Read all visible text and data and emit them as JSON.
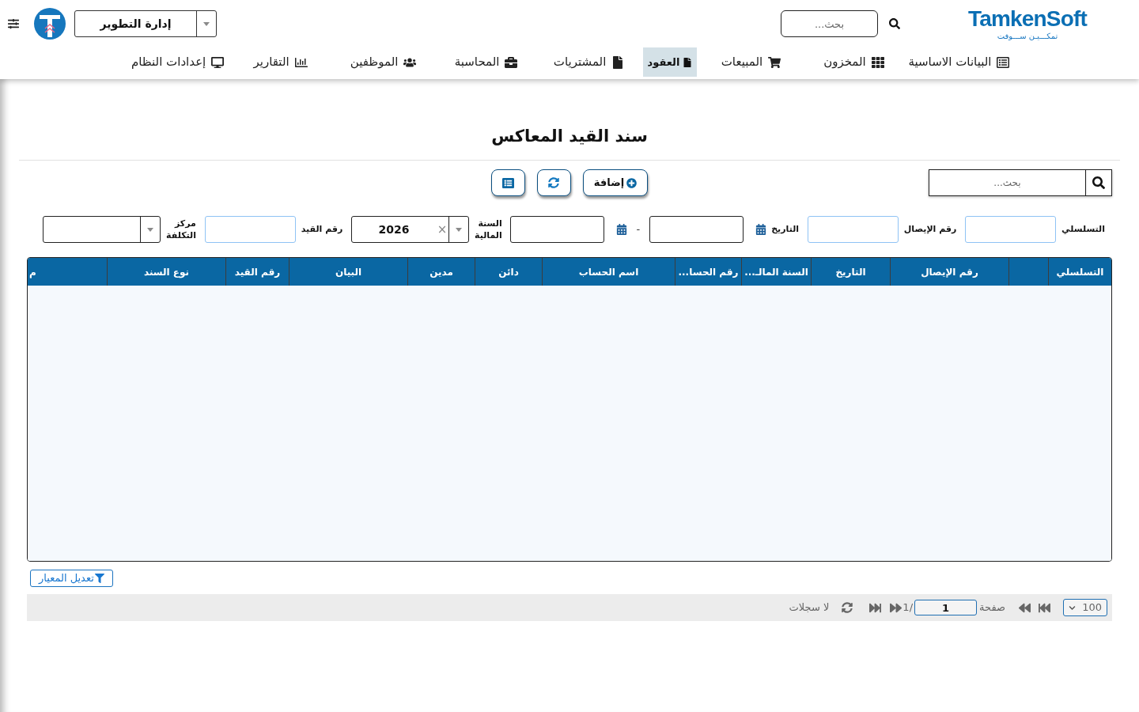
{
  "header": {
    "logo": {
      "name": "TamkenSoft",
      "tagline": "تمكـــيـن ســـوفت"
    },
    "search": {
      "placeholder": "بحث..."
    },
    "department": {
      "value": "إدارة التطوير"
    }
  },
  "nav": [
    {
      "label": "البيانات الاساسية",
      "selected": false
    },
    {
      "label": "المخزون",
      "selected": false
    },
    {
      "label": "المبيعات",
      "selected": false
    },
    {
      "label": "العقود",
      "selected": true
    },
    {
      "label": "المشتريات",
      "selected": false
    },
    {
      "label": "المحاسبة",
      "selected": false
    },
    {
      "label": "الموظفين",
      "selected": false
    },
    {
      "label": "التقارير",
      "selected": false
    },
    {
      "label": "إعدادات النظام",
      "selected": false
    }
  ],
  "page": {
    "title": "سند القيد المعاكس"
  },
  "toolbar": {
    "add_button": "إضافة",
    "search": {
      "placeholder": "بحث..."
    }
  },
  "filters": [
    {
      "kind": "text",
      "label": "التسلسلي"
    },
    {
      "kind": "text",
      "label": "رقم الإيصال"
    },
    {
      "kind": "date_range",
      "label": "التاريخ",
      "separator": "-"
    },
    {
      "kind": "select",
      "label": "السنة المالية",
      "value": "2026",
      "clear": "×"
    },
    {
      "kind": "text",
      "label": "رقم القيد"
    },
    {
      "kind": "select",
      "label": "مركز التكلفة"
    }
  ],
  "table": {
    "columns": [
      {
        "label": "التسلسلي"
      },
      {},
      {
        "label": "رقم الإيصال"
      },
      {
        "label": "التاريخ"
      },
      {
        "label": "السنة المالـ..."
      },
      {
        "label": "رقم الحسا..."
      },
      {
        "label": "اسم الحساب"
      },
      {
        "label": "دائن"
      },
      {
        "label": "مدين"
      },
      {
        "label": "البيان"
      },
      {
        "label": "رقم القيد"
      },
      {
        "label": "نوع السند"
      },
      {
        "label": "م"
      }
    ]
  },
  "criteria_button": "تعديل المعيار",
  "pager": {
    "page_size": "100",
    "page_label": "صفحة",
    "page": "1",
    "page_count": "1/",
    "status": "لا سجلات"
  }
}
